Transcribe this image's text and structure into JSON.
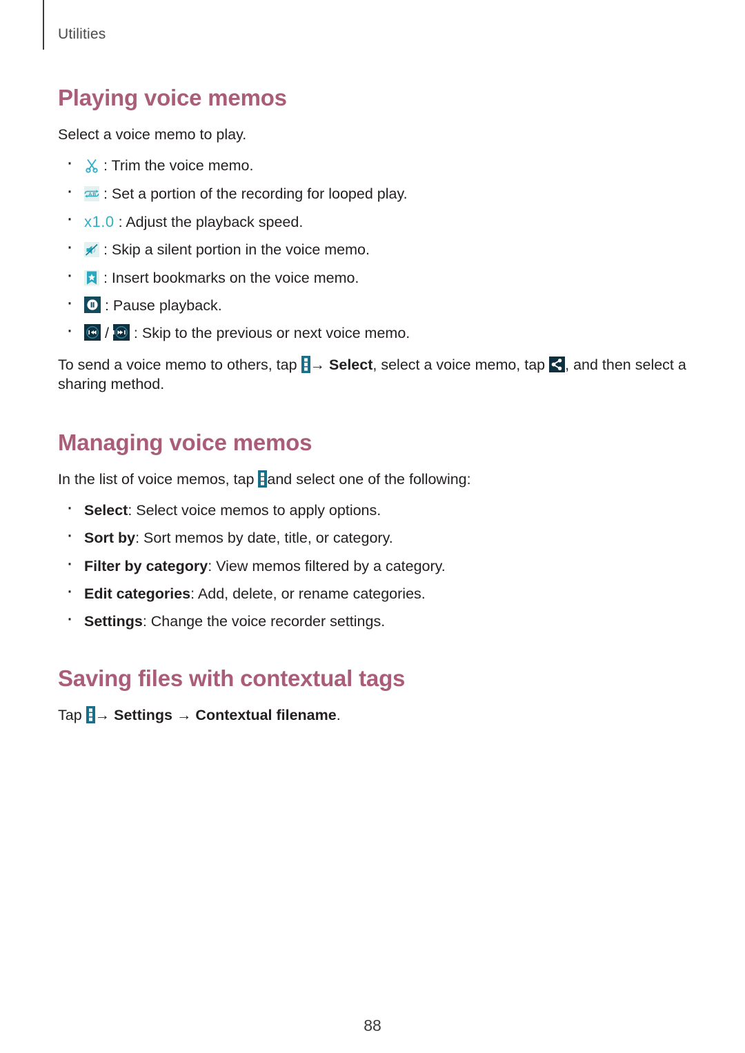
{
  "header": {
    "running_title": "Utilities"
  },
  "colors": {
    "heading": "#a95d78",
    "icon_teal": "#33afc6",
    "icon_dark": "#13404f",
    "body_text": "#231f20"
  },
  "sections": [
    {
      "heading": "Playing voice memos",
      "intro": "Select a voice memo to play.",
      "bullets": [
        {
          "icon": "scissors-icon",
          "separator": ":",
          "text": "Trim the voice memo."
        },
        {
          "icon": "ab-repeat-icon",
          "separator": ":",
          "text": "Set a portion of the recording for looped play."
        },
        {
          "icon": "playback-speed-label",
          "icon_label": "x1.0",
          "separator": ":",
          "text": "Adjust the playback speed."
        },
        {
          "icon": "skip-silence-icon",
          "separator": ":",
          "text": "Skip a silent portion in the voice memo."
        },
        {
          "icon": "bookmark-icon",
          "separator": ":",
          "text": "Insert bookmarks on the voice memo."
        },
        {
          "icon": "pause-icon",
          "separator": ":",
          "text": "Pause playback."
        },
        {
          "icon": "skip-previous-next-icons",
          "separator_mid": "/",
          "separator": ":",
          "text": "Skip to the previous or next voice memo."
        }
      ],
      "paragraph": {
        "part1": "To send a voice memo to others, tap ",
        "arrow1": "→",
        "bold1": "Select",
        "part2": ", select a voice memo, tap ",
        "part3": ", and then select a sharing method."
      }
    },
    {
      "heading": "Managing voice memos",
      "intro": {
        "part1": "In the list of voice memos, tap ",
        "part2": "and select one of the following:"
      },
      "bullets": [
        {
          "term": "Select",
          "desc": ": Select voice memos to apply options."
        },
        {
          "term": "Sort by",
          "desc": ": Sort memos by date, title, or category."
        },
        {
          "term": "Filter by category",
          "desc": ": View memos filtered by a category."
        },
        {
          "term": "Edit categories",
          "desc": ": Add, delete, or rename categories."
        },
        {
          "term": "Settings",
          "desc": ": Change the voice recorder settings."
        }
      ]
    },
    {
      "heading": "Saving files with contextual tags",
      "instruction": {
        "part1": "Tap ",
        "arrow1": "→",
        "bold1": "Settings",
        "arrow2": "→",
        "bold2": "Contextual filename",
        "period": "."
      }
    }
  ],
  "footer": {
    "page_number": "88"
  }
}
